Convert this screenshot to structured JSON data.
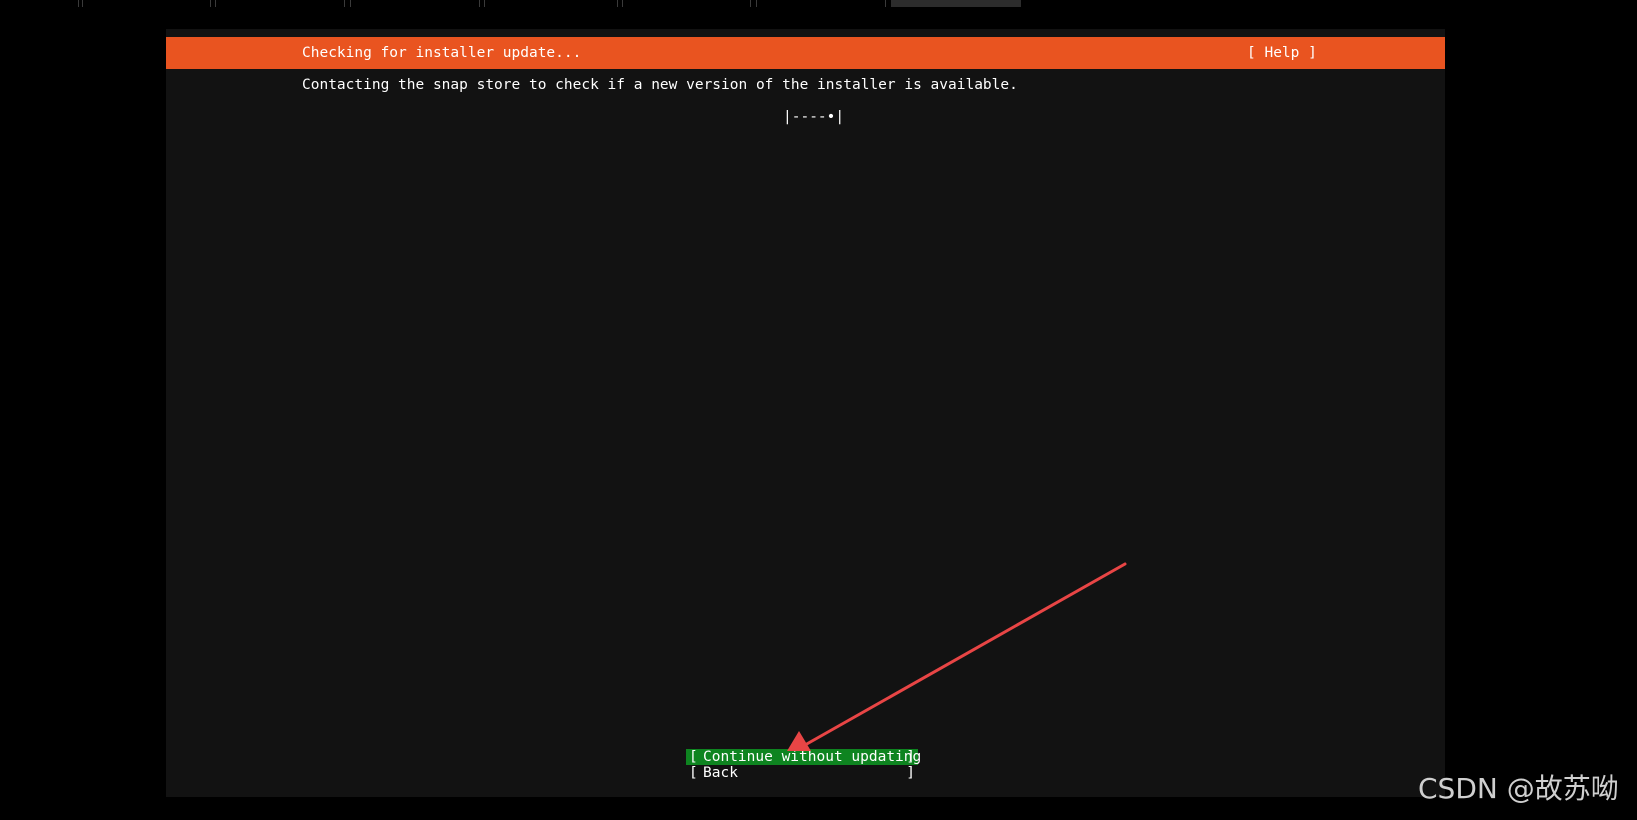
{
  "installer": {
    "header_title": "Checking for installer update...",
    "help_label": "[ Help ]",
    "message": "Contacting the snap store to check if a new version of the installer is available.",
    "spinner": "|----•|",
    "buttons": {
      "continue": {
        "open": "[",
        "label": "Continue without updating",
        "close": "]"
      },
      "back": {
        "open": "[",
        "label": "Back",
        "close": "]"
      }
    }
  },
  "watermark": "CSDN @故苏呦",
  "colors": {
    "header": "#e95420",
    "background": "#121212",
    "focused_button": "#0e8420",
    "annotation_arrow": "#e84545"
  },
  "icons": {
    "annotation": "red-arrow-icon"
  }
}
